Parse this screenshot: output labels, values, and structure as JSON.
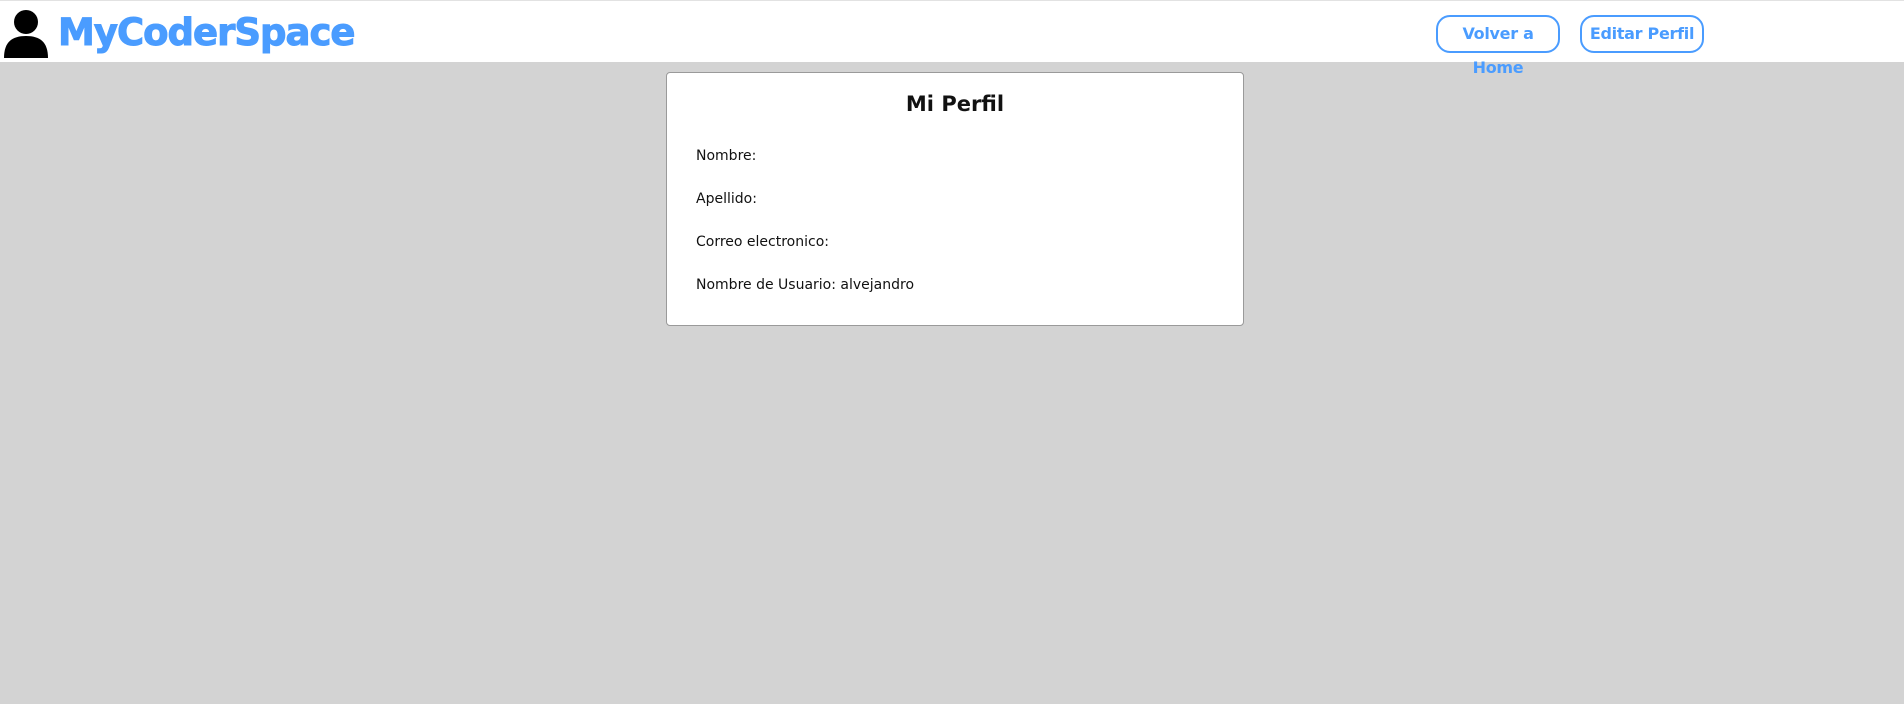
{
  "header": {
    "brand_name": "MyCoderSpace",
    "brand_color": "#4a9cff",
    "user_icon": "user-silhouette-icon",
    "buttons": {
      "home_label": "Volver a Home",
      "edit_label": "Editar Perfil"
    }
  },
  "profile": {
    "title": "Mi Perfil",
    "fields": [
      {
        "label": "Nombre:",
        "value": ""
      },
      {
        "label": "Apellido:",
        "value": ""
      },
      {
        "label": "Correo electronico:",
        "value": ""
      },
      {
        "label": "Nombre de Usuario:",
        "value": "alvejandro"
      }
    ]
  },
  "colors": {
    "page_background": "#d3d3d3",
    "accent": "#4a9cff"
  }
}
